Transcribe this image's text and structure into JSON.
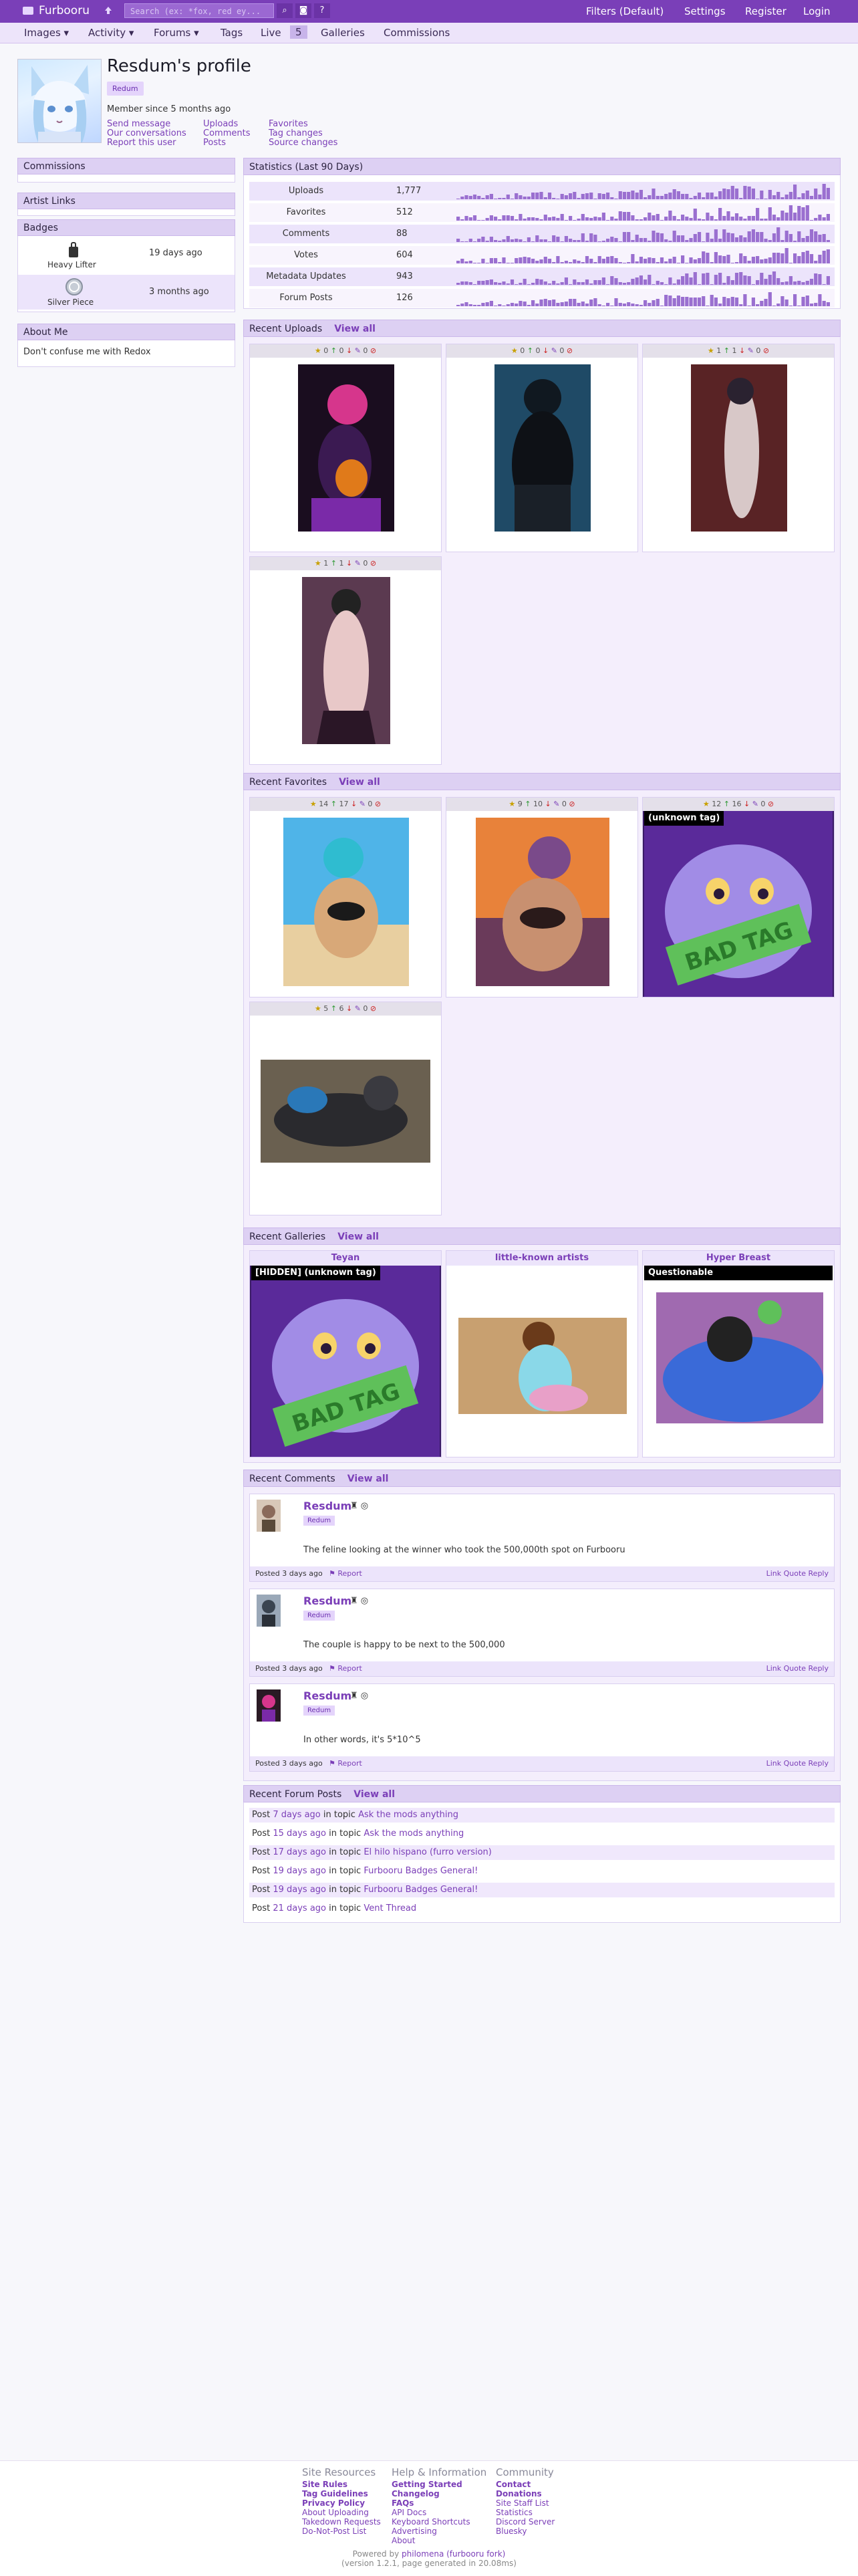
{
  "nav": {
    "site_name": "Furbooru",
    "search_placeholder": "Search (ex: *fox, red ey...",
    "filters": "Filters (Default)",
    "settings": "Settings",
    "register": "Register",
    "login": "Login"
  },
  "subnav": {
    "images": "Images ▾",
    "activity": "Activity ▾",
    "forums": "Forums ▾",
    "tags": "Tags",
    "live": "Live",
    "live_count": "5",
    "galleries": "Galleries",
    "commissions": "Commissions"
  },
  "profile": {
    "title": "Resdum's profile",
    "role": "Redum",
    "member_since": "Member since 5 months ago",
    "links": {
      "send_message": "Send message",
      "our_conversations": "Our conversations",
      "report_user": "Report this user",
      "uploads": "Uploads",
      "comments": "Comments",
      "posts": "Posts",
      "favorites": "Favorites",
      "tag_changes": "Tag changes",
      "source_changes": "Source changes"
    }
  },
  "sidebar": {
    "commissions": "Commissions",
    "artist_links": "Artist Links",
    "badges_title": "Badges",
    "badges": [
      {
        "name": "Heavy Lifter",
        "when": "19 days ago"
      },
      {
        "name": "Silver Piece",
        "when": "3 months ago"
      }
    ],
    "about_title": "About Me",
    "about_text": "Don't confuse me with Redox"
  },
  "stats": {
    "title": "Statistics (Last 90 Days)",
    "rows": [
      {
        "label": "Uploads",
        "value": "1,777"
      },
      {
        "label": "Favorites",
        "value": "512"
      },
      {
        "label": "Comments",
        "value": "88"
      },
      {
        "label": "Votes",
        "value": "604"
      },
      {
        "label": "Metadata Updates",
        "value": "943"
      },
      {
        "label": "Forum Posts",
        "value": "126"
      }
    ]
  },
  "uploads": {
    "title": "Recent Uploads",
    "view_all": "View all",
    "cards": [
      {
        "faves": "0",
        "up": "0",
        "down": "0",
        "comments": "0"
      },
      {
        "faves": "0",
        "up": "0",
        "down": "0",
        "comments": "0"
      },
      {
        "faves": "1",
        "up": "1",
        "down": "1",
        "comments": "0"
      },
      {
        "faves": "1",
        "up": "1",
        "down": "1",
        "comments": "0"
      }
    ]
  },
  "favorites": {
    "title": "Recent Favorites",
    "view_all": "View all",
    "cards": [
      {
        "faves": "14",
        "up": "17",
        "down": "0",
        "comments": "0"
      },
      {
        "faves": "9",
        "up": "10",
        "down": "0",
        "comments": "0"
      },
      {
        "faves": "12",
        "up": "16",
        "down": "0",
        "comments": "0",
        "tag": "(unknown tag)",
        "sticker": "BAD TAG"
      },
      {
        "faves": "5",
        "up": "6",
        "down": "0",
        "comments": "0"
      }
    ]
  },
  "galleries": {
    "title": "Recent Galleries",
    "view_all": "View all",
    "items": [
      {
        "name": "Teyan",
        "tag": "[HIDDEN] (unknown tag)",
        "sticker": "BAD TAG"
      },
      {
        "name": "little-known artists",
        "tag": ""
      },
      {
        "name": "Hyper Breast",
        "tag": "Questionable"
      }
    ]
  },
  "comments": {
    "title": "Recent Comments",
    "view_all": "View all",
    "items": [
      {
        "author": "Resdum",
        "role": "Redum",
        "text": "The feline looking at the winner who took the 500,000th spot on Furbooru",
        "posted": "Posted 3 days ago",
        "report": "Report",
        "actions": "Link  Quote  Reply"
      },
      {
        "author": "Resdum",
        "role": "Redum",
        "text": "The couple is happy to be next to the 500,000",
        "posted": "Posted 3 days ago",
        "report": "Report",
        "actions": "Link  Quote  Reply"
      },
      {
        "author": "Resdum",
        "role": "Redum",
        "text": "In other words, it's 5*10^5",
        "posted": "Posted 3 days ago",
        "report": "Report",
        "actions": "Link  Quote  Reply"
      }
    ]
  },
  "forum": {
    "title": "Recent Forum Posts",
    "view_all": "View all",
    "posts": [
      {
        "when": "7 days ago",
        "topic": "Ask the mods anything"
      },
      {
        "when": "15 days ago",
        "topic": "Ask the mods anything"
      },
      {
        "when": "17 days ago",
        "topic": "El hilo hispano (furro version)"
      },
      {
        "when": "19 days ago",
        "topic": "Furbooru Badges General!"
      },
      {
        "when": "19 days ago",
        "topic": "Furbooru Badges General!"
      },
      {
        "when": "21 days ago",
        "topic": "Vent Thread"
      }
    ],
    "post_word": "Post",
    "in_topic": "in topic"
  },
  "footer": {
    "site_resources": "Site Resources",
    "sr_links": [
      "Site Rules",
      "Tag Guidelines",
      "Privacy Policy",
      "About Uploading",
      "Takedown Requests",
      "Do-Not-Post List"
    ],
    "help": "Help & Information",
    "help_links": [
      "Getting Started",
      "Changelog",
      "FAQs",
      "API Docs",
      "Keyboard Shortcuts",
      "Advertising",
      "About"
    ],
    "community": "Community",
    "community_links": [
      "Contact",
      "Donations",
      "Site Staff List",
      "Statistics",
      "Discord Server",
      "Bluesky"
    ],
    "powered_prefix": "Powered by",
    "powered_name": "philomena (furbooru fork)",
    "version": "(version 1.2.1, page generated in 20.08ms)"
  },
  "colors": {
    "accent": "#7a3fb8",
    "header_bg": "#ddd0f3",
    "spark": "#9a6fd0"
  }
}
